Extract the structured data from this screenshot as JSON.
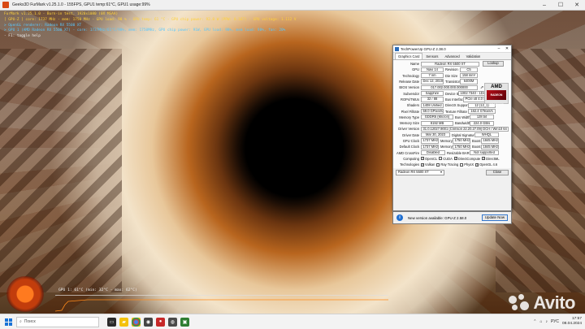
{
  "furmark": {
    "title": "Geeks3D FurMark v1.25.1.0 - 155FPS, GPU1 temp:61°C, GPU1 usage:99%",
    "overlay": [
      "FurMark v1.25.1.0 - Burn-in test, 1920x1080 (0X MSAA)",
      "[ GPU-Z ] core: 1737 MHz - mem: 1750 MHz - GPU load: 98 % - GPU temp: 61 °C - GPU chip power: 92.8 W (PPW: 0.167) - GPU voltage: 1.112 V",
      "> OpenGL renderer: Radeon RX 5500 XT",
      "> GPU 1 (AMD Radeon RX 5500 XT) - core: 1737MHz/61°C/98%, mem: 1750MHz, GPU chip power: 91W, GPU load: 98%, mem load: 98%, fan: 20%",
      "- F1: toggle help"
    ],
    "graph_label": "GPU 1: 61°C (min: 32°C - max: 62°C)"
  },
  "gpuz": {
    "title": "TechPowerUp GPU-Z 2.38.0",
    "tabs": [
      "Graphics Card",
      "Sensors",
      "Advanced",
      "Validation"
    ],
    "lookup": "Lookup",
    "name": {
      "label": "Name",
      "value": "Radeon RX 5500 XT"
    },
    "gpu": {
      "label": "GPU",
      "value": "Navi 14",
      "rev_label": "Revision",
      "rev_value": "C5"
    },
    "technology": {
      "label": "Technology",
      "value": "7 nm",
      "die_label": "Die Size",
      "die_value": "158 mm²"
    },
    "release": {
      "label": "Release Date",
      "value": "Dec 12, 2019",
      "trans_label": "Transistors",
      "trans_value": "6400M"
    },
    "bios": {
      "label": "BIOS Version",
      "value": "017.002.000.000.000000",
      "uefi_label": "UEFI"
    },
    "subvendor": {
      "label": "Subvendor",
      "value": "Sapphire",
      "dev_label": "Device ID",
      "dev_value": "1002 7340 - 1DA2 E421"
    },
    "rops": {
      "label": "ROPs/TMUs",
      "value": "32 / 88",
      "bus_label": "Bus Interface",
      "bus_value": "PCIe x8 4.0 @ x8 3.0"
    },
    "shaders": {
      "label": "Shaders",
      "value": "1408 Unified",
      "dx_label": "DirectX Support",
      "dx_value": "12 (12_1)"
    },
    "pixel": {
      "label": "Pixel Fillrate",
      "value": "59.0 GPixel/s",
      "tex_label": "Texture Fillrate",
      "tex_value": "162.4 GTexel/s"
    },
    "memtype": {
      "label": "Memory Type",
      "value": "GDDR6 (Micron)",
      "bw_label": "Bus Width",
      "bw_value": "128 bit"
    },
    "memsize": {
      "label": "Memory Size",
      "value": "8192 MB",
      "band_label": "Bandwidth",
      "band_value": "224.0 GB/s"
    },
    "driver": {
      "label": "Driver Version",
      "value": "31.0.12027.9001 (Crimson 22.20.27.09) DCH / Win10 64"
    },
    "driverdate": {
      "label": "Driver Date",
      "value": "Mar 30, 2023",
      "sig_label": "Digital Signature",
      "sig_value": "WHQL"
    },
    "gpuclock": {
      "label": "GPU Clock",
      "value": "1737 MHz",
      "mem_label": "Memory",
      "mem_value": "1750 MHz",
      "boost_label": "Boost",
      "boost_value": "1845 MHz"
    },
    "defclock": {
      "label": "Default Clock",
      "value": "1737 MHz",
      "mem_label": "Memory",
      "mem_value": "1750 MHz",
      "boost_label": "Boost",
      "boost_value": "1845 MHz"
    },
    "crossfire": {
      "label": "AMD CrossFire",
      "value": "Disabled",
      "rbar_label": "Resizable BAR",
      "rbar_value": "Not supported"
    },
    "computing": {
      "label": "Computing",
      "items": [
        "OpenCL",
        "CUDA",
        "DirectCompute",
        "DirectML"
      ],
      "checked": [
        true,
        false,
        true,
        true
      ]
    },
    "technologies": {
      "label": "Technologies",
      "items": [
        "Vulkan",
        "Ray Tracing",
        "PhysX",
        "OpenGL 4.6"
      ],
      "checked": [
        true,
        false,
        false,
        true
      ]
    },
    "selected_gpu": "Radeon RX 5500 XT",
    "close": "Close",
    "amd_logo": "AMD",
    "radeon_logo": "RADEON GRAPHICS"
  },
  "update": {
    "message": "New version available: GPU-Z 2.58.0",
    "button": "Update Now"
  },
  "taskbar": {
    "search_placeholder": "Поиск",
    "lang": "РУС",
    "time": "17:57",
    "date": "08.04.2024"
  },
  "watermark": "Avito"
}
